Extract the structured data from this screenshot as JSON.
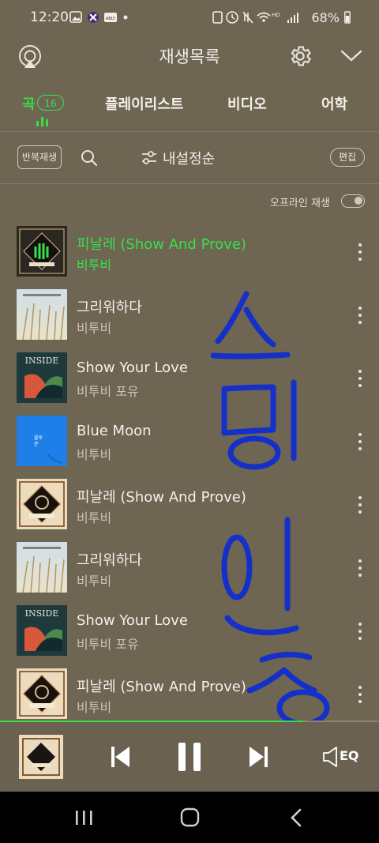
{
  "status": {
    "time": "12:20",
    "battery": "68%"
  },
  "header": {
    "title": "재생목록"
  },
  "tabs": [
    {
      "label": "곡",
      "count": "16"
    },
    {
      "label": "플레이리스트"
    },
    {
      "label": "비디오"
    },
    {
      "label": "어학"
    }
  ],
  "toolbar": {
    "repeat_label": "반복재생",
    "sort_label": "내설정순",
    "edit_label": "편집"
  },
  "offline": {
    "label": "오프라인 재생",
    "enabled": false
  },
  "songs": [
    {
      "title": "피날레 (Show And Prove)",
      "artist": "비투비",
      "art": "album-finale",
      "playing": true
    },
    {
      "title": "그리워하다",
      "artist": "비투비",
      "art": "album-reeds"
    },
    {
      "title": "Show Your Love",
      "artist": "비투비 포유",
      "art": "album-inside"
    },
    {
      "title": "Blue Moon",
      "artist": "비투비",
      "art": "album-bluemoon"
    },
    {
      "title": "피날레 (Show And Prove)",
      "artist": "비투비",
      "art": "album-kingdom"
    },
    {
      "title": "그리워하다",
      "artist": "비투비",
      "art": "album-reeds"
    },
    {
      "title": "Show Your Love",
      "artist": "비투비 포유",
      "art": "album-inside"
    },
    {
      "title": "피날레 (Show And Prove)",
      "artist": "비투비",
      "art": "album-kingdom"
    }
  ],
  "player": {
    "progress": 0.8,
    "eq_label": "EQ"
  },
  "colors": {
    "accent": "#37e04a",
    "background": "#6e6553",
    "ink_annotation": "#1530c8"
  }
}
